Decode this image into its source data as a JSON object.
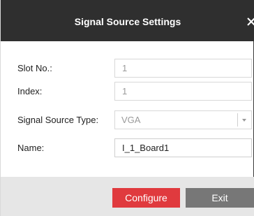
{
  "dialog": {
    "title": "Signal Source Settings",
    "close_icon": "close-icon"
  },
  "form": {
    "slot_no": {
      "label": "Slot No.:",
      "value": "1"
    },
    "index": {
      "label": "Index:",
      "value": "1"
    },
    "signal_source_type": {
      "label": "Signal Source Type:",
      "value": "VGA",
      "icon": "chevron-down-icon"
    },
    "name": {
      "label": "Name:",
      "value": "I_1_Board1"
    }
  },
  "buttons": {
    "configure_label": "Configure",
    "exit_label": "Exit"
  },
  "colors": {
    "titlebar": "#2f2f2f",
    "configure": "#e03a3e",
    "exit": "#777777",
    "footer": "#e6e6e6"
  }
}
